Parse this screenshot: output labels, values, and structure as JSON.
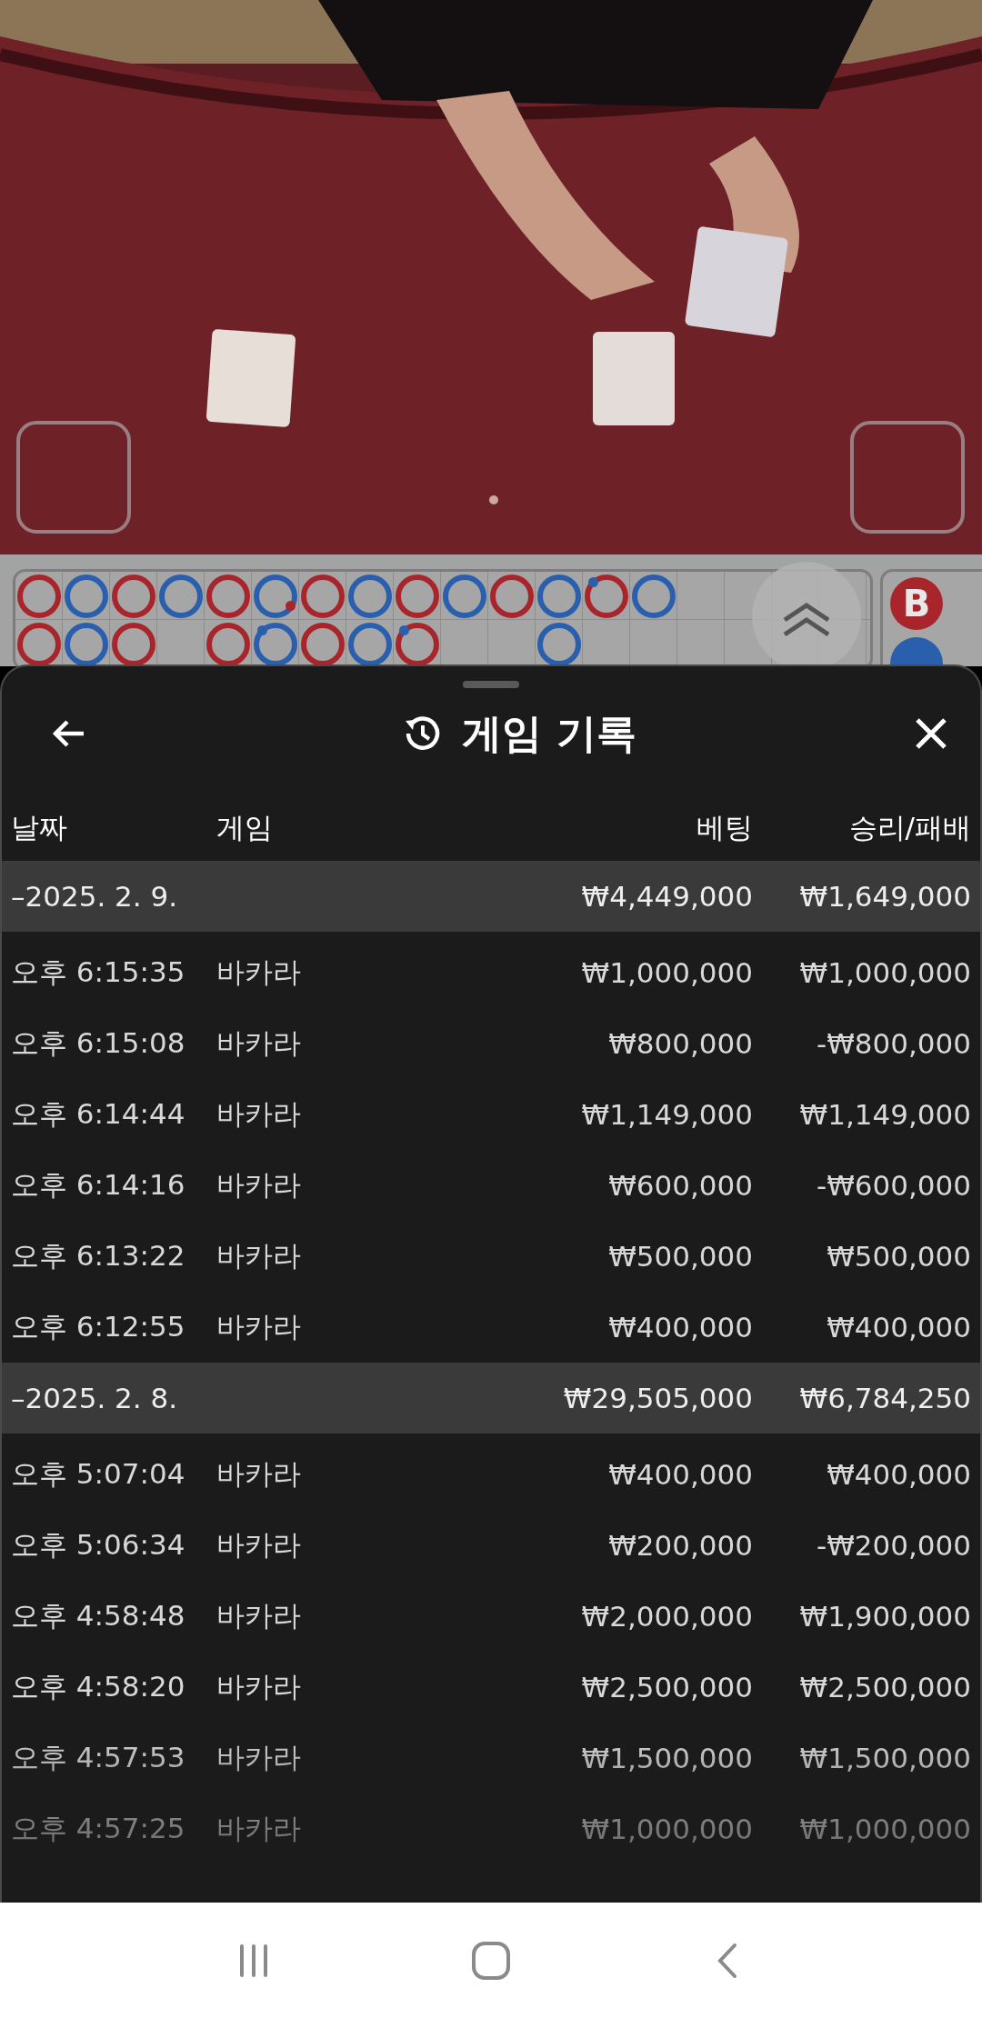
{
  "bead_road": {
    "rows": [
      [
        {
          "color": "#a8262b"
        },
        {
          "color": "#2a5fae"
        },
        {
          "color": "#a8262b"
        },
        {
          "color": "#2a5fae"
        },
        {
          "color": "#a8262b"
        },
        {
          "color": "#2a5fae",
          "dot": {
            "kind": "lower",
            "color": "#a8262b"
          }
        },
        {
          "color": "#a8262b"
        },
        {
          "color": "#2a5fae"
        },
        {
          "color": "#a8262b"
        },
        {
          "color": "#2a5fae"
        },
        {
          "color": "#a8262b"
        },
        {
          "color": "#2a5fae"
        },
        {
          "color": "#a8262b",
          "dot": {
            "kind": "upper",
            "color": "#2a5fae"
          }
        },
        {
          "color": "#2a5fae"
        },
        null,
        null,
        null,
        null
      ],
      [
        {
          "color": "#a8262b"
        },
        {
          "color": "#2a5fae"
        },
        {
          "color": "#a8262b"
        },
        null,
        {
          "color": "#a8262b"
        },
        {
          "color": "#2a5fae",
          "dot": {
            "kind": "upper",
            "color": "#2a5fae"
          }
        },
        {
          "color": "#a8262b"
        },
        {
          "color": "#2a5fae"
        },
        {
          "color": "#a8262b",
          "dot": {
            "kind": "upper",
            "color": "#2a5fae"
          }
        },
        null,
        null,
        {
          "color": "#2a5fae"
        },
        null,
        null,
        null,
        null,
        null,
        null
      ]
    ]
  },
  "side_road": {
    "cells": [
      {
        "text": "B",
        "color": "#a8262b"
      },
      {
        "color": "#2a5fae"
      }
    ]
  },
  "sheet": {
    "title": "게임 기록",
    "columns": [
      "날짜",
      "게임",
      "베팅",
      "승리/패배"
    ],
    "groups": [
      {
        "date": "–2025. 2. 9.",
        "bet": "₩4,449,000",
        "result": "₩1,649,000",
        "rows": [
          {
            "time": "오후 6:15:35",
            "game": "바카라",
            "bet": "₩1,000,000",
            "result": "₩1,000,000"
          },
          {
            "time": "오후 6:15:08",
            "game": "바카라",
            "bet": "₩800,000",
            "result": "-₩800,000"
          },
          {
            "time": "오후 6:14:44",
            "game": "바카라",
            "bet": "₩1,149,000",
            "result": "₩1,149,000"
          },
          {
            "time": "오후 6:14:16",
            "game": "바카라",
            "bet": "₩600,000",
            "result": "-₩600,000"
          },
          {
            "time": "오후 6:13:22",
            "game": "바카라",
            "bet": "₩500,000",
            "result": "₩500,000"
          },
          {
            "time": "오후 6:12:55",
            "game": "바카라",
            "bet": "₩400,000",
            "result": "₩400,000"
          }
        ]
      },
      {
        "date": "–2025. 2. 8.",
        "bet": "₩29,505,000",
        "result": "₩6,784,250",
        "rows": [
          {
            "time": "오후 5:07:04",
            "game": "바카라",
            "bet": "₩400,000",
            "result": "₩400,000"
          },
          {
            "time": "오후 5:06:34",
            "game": "바카라",
            "bet": "₩200,000",
            "result": "-₩200,000"
          },
          {
            "time": "오후 4:58:48",
            "game": "바카라",
            "bet": "₩2,000,000",
            "result": "₩1,900,000"
          },
          {
            "time": "오후 4:58:20",
            "game": "바카라",
            "bet": "₩2,500,000",
            "result": "₩2,500,000"
          },
          {
            "time": "오후 4:57:53",
            "game": "바카라",
            "bet": "₩1,500,000",
            "result": "₩1,500,000"
          },
          {
            "time": "오후 4:57:25",
            "game": "바카라",
            "bet": "₩1,000,000",
            "result": "₩1,000,000"
          }
        ]
      }
    ]
  }
}
